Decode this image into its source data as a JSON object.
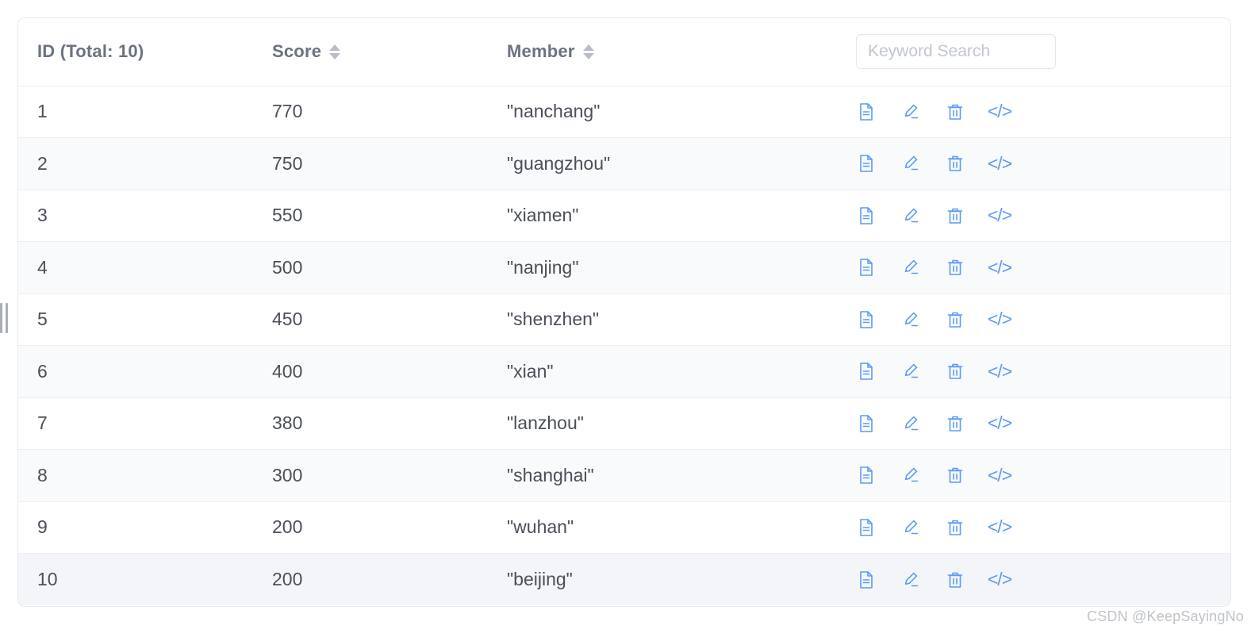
{
  "panel": {
    "drag_handle_label": "resize-handle"
  },
  "table": {
    "columns": [
      {
        "key": "id",
        "label": "ID (Total: 10)",
        "sortable": false
      },
      {
        "key": "score",
        "label": "Score",
        "sortable": true
      },
      {
        "key": "member",
        "label": "Member",
        "sortable": true
      },
      {
        "key": "actions",
        "label": "",
        "sortable": false
      }
    ],
    "total": 10,
    "rows": [
      {
        "id": "1",
        "score": "770",
        "member": "\"nanchang\""
      },
      {
        "id": "2",
        "score": "750",
        "member": "\"guangzhou\""
      },
      {
        "id": "3",
        "score": "550",
        "member": "\"xiamen\""
      },
      {
        "id": "4",
        "score": "500",
        "member": "\"nanjing\""
      },
      {
        "id": "5",
        "score": "450",
        "member": "\"shenzhen\""
      },
      {
        "id": "6",
        "score": "400",
        "member": "\"xian\""
      },
      {
        "id": "7",
        "score": "380",
        "member": "\"lanzhou\""
      },
      {
        "id": "8",
        "score": "300",
        "member": "\"shanghai\""
      },
      {
        "id": "9",
        "score": "200",
        "member": "\"wuhan\""
      },
      {
        "id": "10",
        "score": "200",
        "member": "\"beijing\""
      }
    ],
    "row_actions": [
      {
        "icon": "document-icon",
        "label": "View details"
      },
      {
        "icon": "pencil-icon",
        "label": "Edit"
      },
      {
        "icon": "trash-icon",
        "label": "Delete"
      },
      {
        "icon": "code-icon",
        "label": "</>"
      }
    ]
  },
  "search": {
    "value": "",
    "placeholder": "Keyword Search"
  },
  "watermark": {
    "text": "CSDN @KeepSayingNo"
  },
  "colors": {
    "accent": "#5c9bf5",
    "header_text": "#6b7280",
    "body_text": "#4a4f58",
    "row_alt_bg": "#f9fafb",
    "row_last_bg": "#f4f5f9",
    "border": "#eceef3",
    "placeholder": "#c2c6cf"
  }
}
